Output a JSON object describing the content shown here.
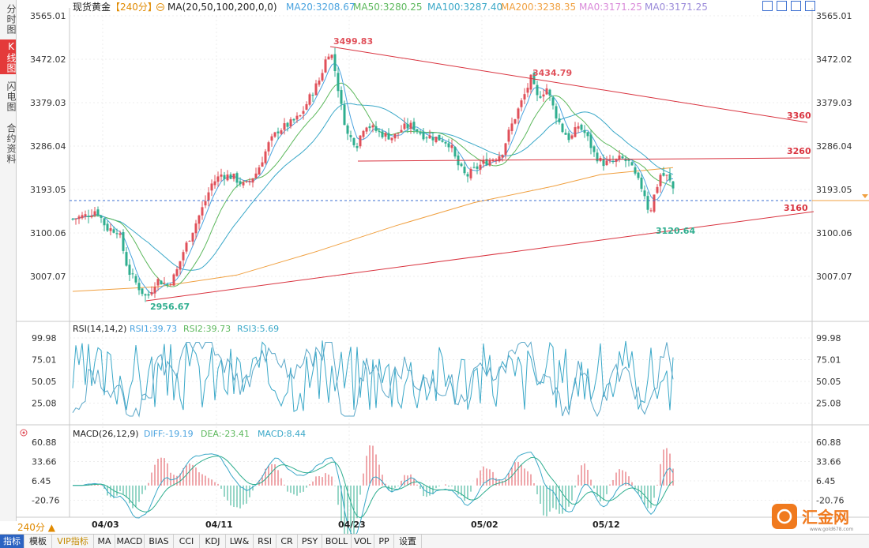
{
  "sidebar": {
    "tabs": [
      {
        "label": "分时图",
        "active": false
      },
      {
        "label": "K线图",
        "active": true
      },
      {
        "label": "闪电图",
        "active": false
      },
      {
        "label": "合约资料",
        "active": false
      }
    ]
  },
  "header": {
    "symbol": "现货黄金",
    "period_tag": "【240分】",
    "ma_params": "MA(20,50,100,200,0,0)",
    "ma_values": [
      {
        "label": "MA20:3208.67",
        "color": "#4aa3df"
      },
      {
        "label": "MA50:3280.25",
        "color": "#5cb85c"
      },
      {
        "label": "MA100:3287.40",
        "color": "#3aa8c8"
      },
      {
        "label": "MA200:3238.35",
        "color": "#f0a040"
      },
      {
        "label": "MA0:3171.25",
        "color": "#d98ad9"
      },
      {
        "label": "MA0:3171.25",
        "color": "#9a8ad9"
      }
    ]
  },
  "price_axis": {
    "ticks": [
      "3565.01",
      "3472.02",
      "3379.03",
      "3286.04",
      "3193.05",
      "3100.06",
      "3007.07"
    ]
  },
  "annotations": {
    "high1": "3499.83",
    "high2": "3434.79",
    "low1": "2956.67",
    "low2": "3120.64",
    "level_a": "3360",
    "level_b": "3260",
    "level_c": "3160"
  },
  "rsi": {
    "title": "RSI(14,14,2)",
    "rsi1": "RSI1:39.73",
    "rsi2": "RSI2:39.73",
    "rsi3": "RSI3:5.69",
    "ticks": [
      "99.98",
      "75.01",
      "50.05",
      "25.08"
    ]
  },
  "macd": {
    "title": "MACD(26,12,9)",
    "diff": "DIFF:-19.19",
    "dea": "DEA:-23.41",
    "macd": "MACD:8.44",
    "ticks": [
      "60.88",
      "33.66",
      "6.45",
      "-20.76"
    ]
  },
  "x_axis": {
    "dates": [
      "04/03",
      "04/11",
      "04/23",
      "05/02",
      "05/12"
    ]
  },
  "period_selector": "240分",
  "bottom_toolbar": [
    {
      "label": "指标",
      "active": true
    },
    {
      "label": "模板"
    },
    {
      "label": "VIP指标",
      "vip": true
    },
    {
      "label": "MA"
    },
    {
      "label": "MACD"
    },
    {
      "label": "BIAS"
    },
    {
      "label": "CCI"
    },
    {
      "label": "KDJ"
    },
    {
      "label": "LW&"
    },
    {
      "label": "RSI"
    },
    {
      "label": "CR"
    },
    {
      "label": "PSY"
    },
    {
      "label": "BOLL"
    },
    {
      "label": "VOL"
    },
    {
      "label": "PP"
    },
    {
      "label": "设置"
    }
  ],
  "logo": {
    "text": "汇金网",
    "sub": "www.gold678.com"
  },
  "colors": {
    "up": "#e0505a",
    "down": "#2fae8f",
    "trend": "#d9333f",
    "dash": "#3b6fd0",
    "ma200": "#f0a040"
  }
}
